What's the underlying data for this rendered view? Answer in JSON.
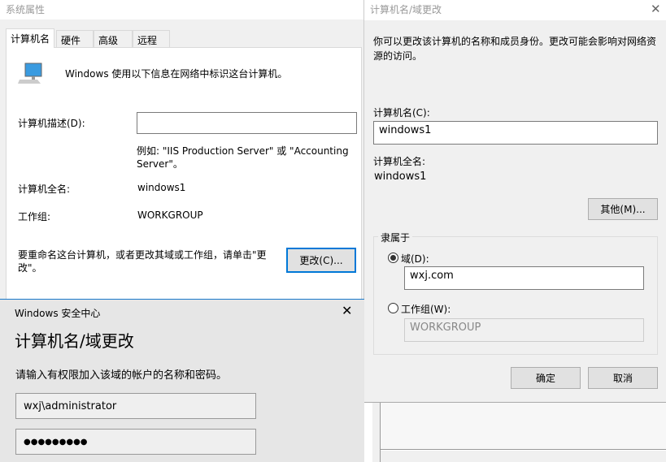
{
  "sys": {
    "title": "系统属性",
    "tabs": [
      "计算机名",
      "硬件",
      "高级",
      "远程"
    ],
    "intro": "Windows 使用以下信息在网络中标识这台计算机。",
    "desc_label": "计算机描述(D):",
    "desc_value": "",
    "example_line1": "例如: \"IIS Production Server\" 或 \"Accounting",
    "example_line2": "Server\"。",
    "fullname_label": "计算机全名:",
    "fullname_value": "windows1",
    "workgroup_label": "工作组:",
    "workgroup_value": "WORKGROUP",
    "rename_line1": "要重命名这台计算机，或者更改其域或工作组，请单击\"更",
    "rename_line2": "改\"。",
    "change_button": "更改(C)..."
  },
  "sec": {
    "title": "Windows 安全中心",
    "heading": "计算机名/域更改",
    "prompt": "请输入有权限加入该域的帐户的名称和密码。",
    "username": "wxj\\administrator",
    "password": "●●●●●●●●●"
  },
  "chg": {
    "title": "计算机名/域更改",
    "intro_line1": "你可以更改该计算机的名称和成员身份。更改可能会影响对网络资",
    "intro_line2": "源的访问。",
    "name_label": "计算机名(C):",
    "name_value": "windows1",
    "fullname_label": "计算机全名:",
    "fullname_value": "windows1",
    "more_button": "其他(M)...",
    "member_of": "隶属于",
    "domain_label": "域(D):",
    "domain_value": "wxj.com",
    "workgroup_label": "工作组(W):",
    "workgroup_value": "WORKGROUP",
    "ok": "确定",
    "cancel": "取消"
  }
}
